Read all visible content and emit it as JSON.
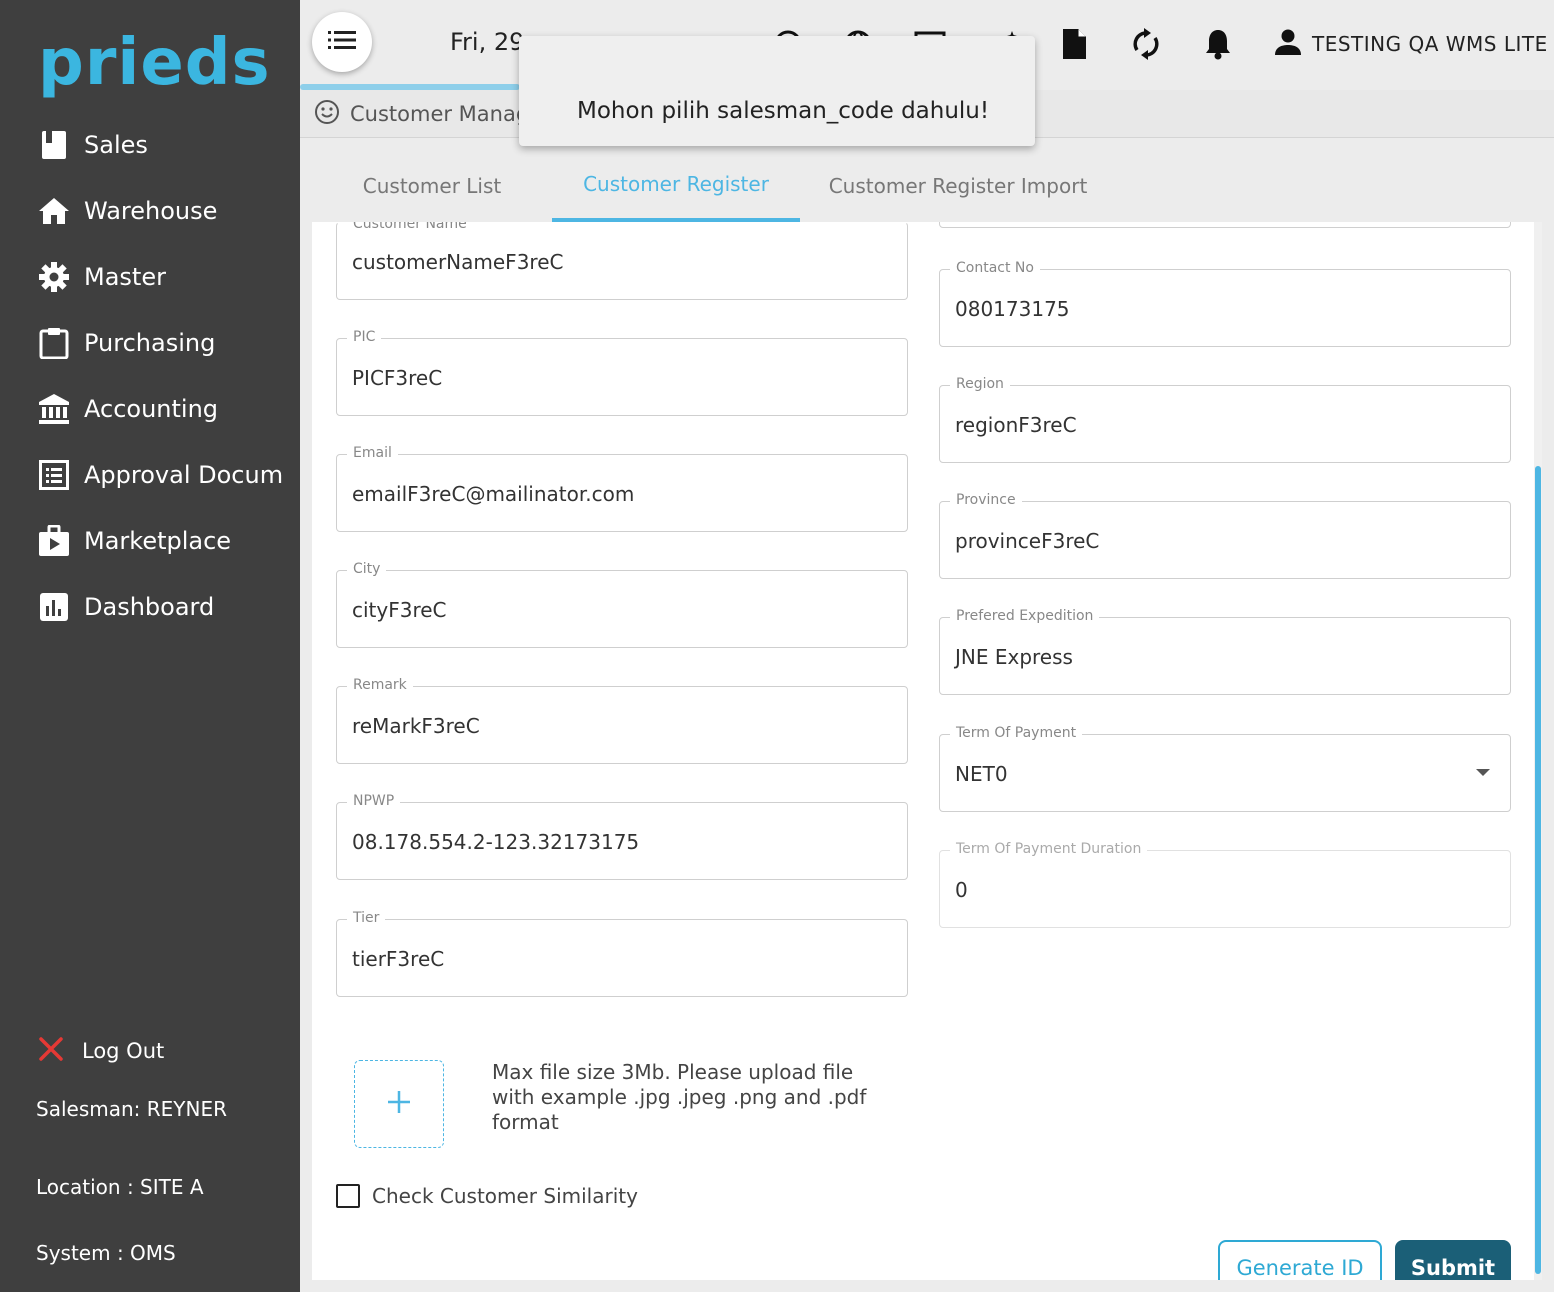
{
  "brand": {
    "logo_text": "prieds",
    "color": "#3bb6e0"
  },
  "sidebar": {
    "items": [
      {
        "label": "Sales",
        "icon": "book-icon"
      },
      {
        "label": "Warehouse",
        "icon": "home-icon"
      },
      {
        "label": "Master",
        "icon": "gear-icon"
      },
      {
        "label": "Purchasing",
        "icon": "clipboard-icon"
      },
      {
        "label": "Accounting",
        "icon": "bank-icon"
      },
      {
        "label": "Approval Docum",
        "icon": "list-icon"
      },
      {
        "label": "Marketplace",
        "icon": "play-bag-icon"
      },
      {
        "label": "Dashboard",
        "icon": "chart-icon"
      }
    ],
    "logout_label": "Log Out",
    "salesman": "Salesman: REYNER",
    "location": "Location : SITE A",
    "system": "System : OMS"
  },
  "topbar": {
    "date_text": "Fri, 29",
    "user_name": "TESTING QA WMS LITE"
  },
  "breadcrumb": {
    "label": "Customer Manage"
  },
  "tabs": [
    {
      "label": "Customer List"
    },
    {
      "label": "Customer Register"
    },
    {
      "label": "Customer Register Import"
    }
  ],
  "form": {
    "left": [
      {
        "label": "Customer Name",
        "value": "customerNameF3reC"
      },
      {
        "label": "PIC",
        "value": "PICF3reC"
      },
      {
        "label": "Email",
        "value": "emailF3reC@mailinator.com"
      },
      {
        "label": "City",
        "value": "cityF3reC"
      },
      {
        "label": "Remark",
        "value": "reMarkF3reC"
      },
      {
        "label": "NPWP",
        "value": "08.178.554.2-123.32173175"
      },
      {
        "label": "Tier",
        "value": "tierF3reC"
      }
    ],
    "right": [
      {
        "label": "Contact No",
        "value": "080173175"
      },
      {
        "label": "Region",
        "value": "regionF3reC"
      },
      {
        "label": "Province",
        "value": "provinceF3reC"
      },
      {
        "label": "Prefered Expedition",
        "value": "JNE Express"
      },
      {
        "label": "Term Of Payment",
        "value": "NET0"
      },
      {
        "label": "Term Of Payment Duration",
        "value": "0"
      }
    ],
    "upload_note": "Max file size 3Mb. Please upload file with example .jpg .jpeg .png and .pdf format",
    "check_similarity_label": "Check Customer Similarity",
    "generate_id_label": "Generate ID",
    "submit_label": "Submit"
  },
  "toast": {
    "message": "Mohon pilih salesman_code dahulu!"
  },
  "colors": {
    "accent": "#4db6e3",
    "sidebar_bg": "#3f3f3f",
    "submit_bg": "#1b5f77",
    "logout_x": "#e53935"
  }
}
